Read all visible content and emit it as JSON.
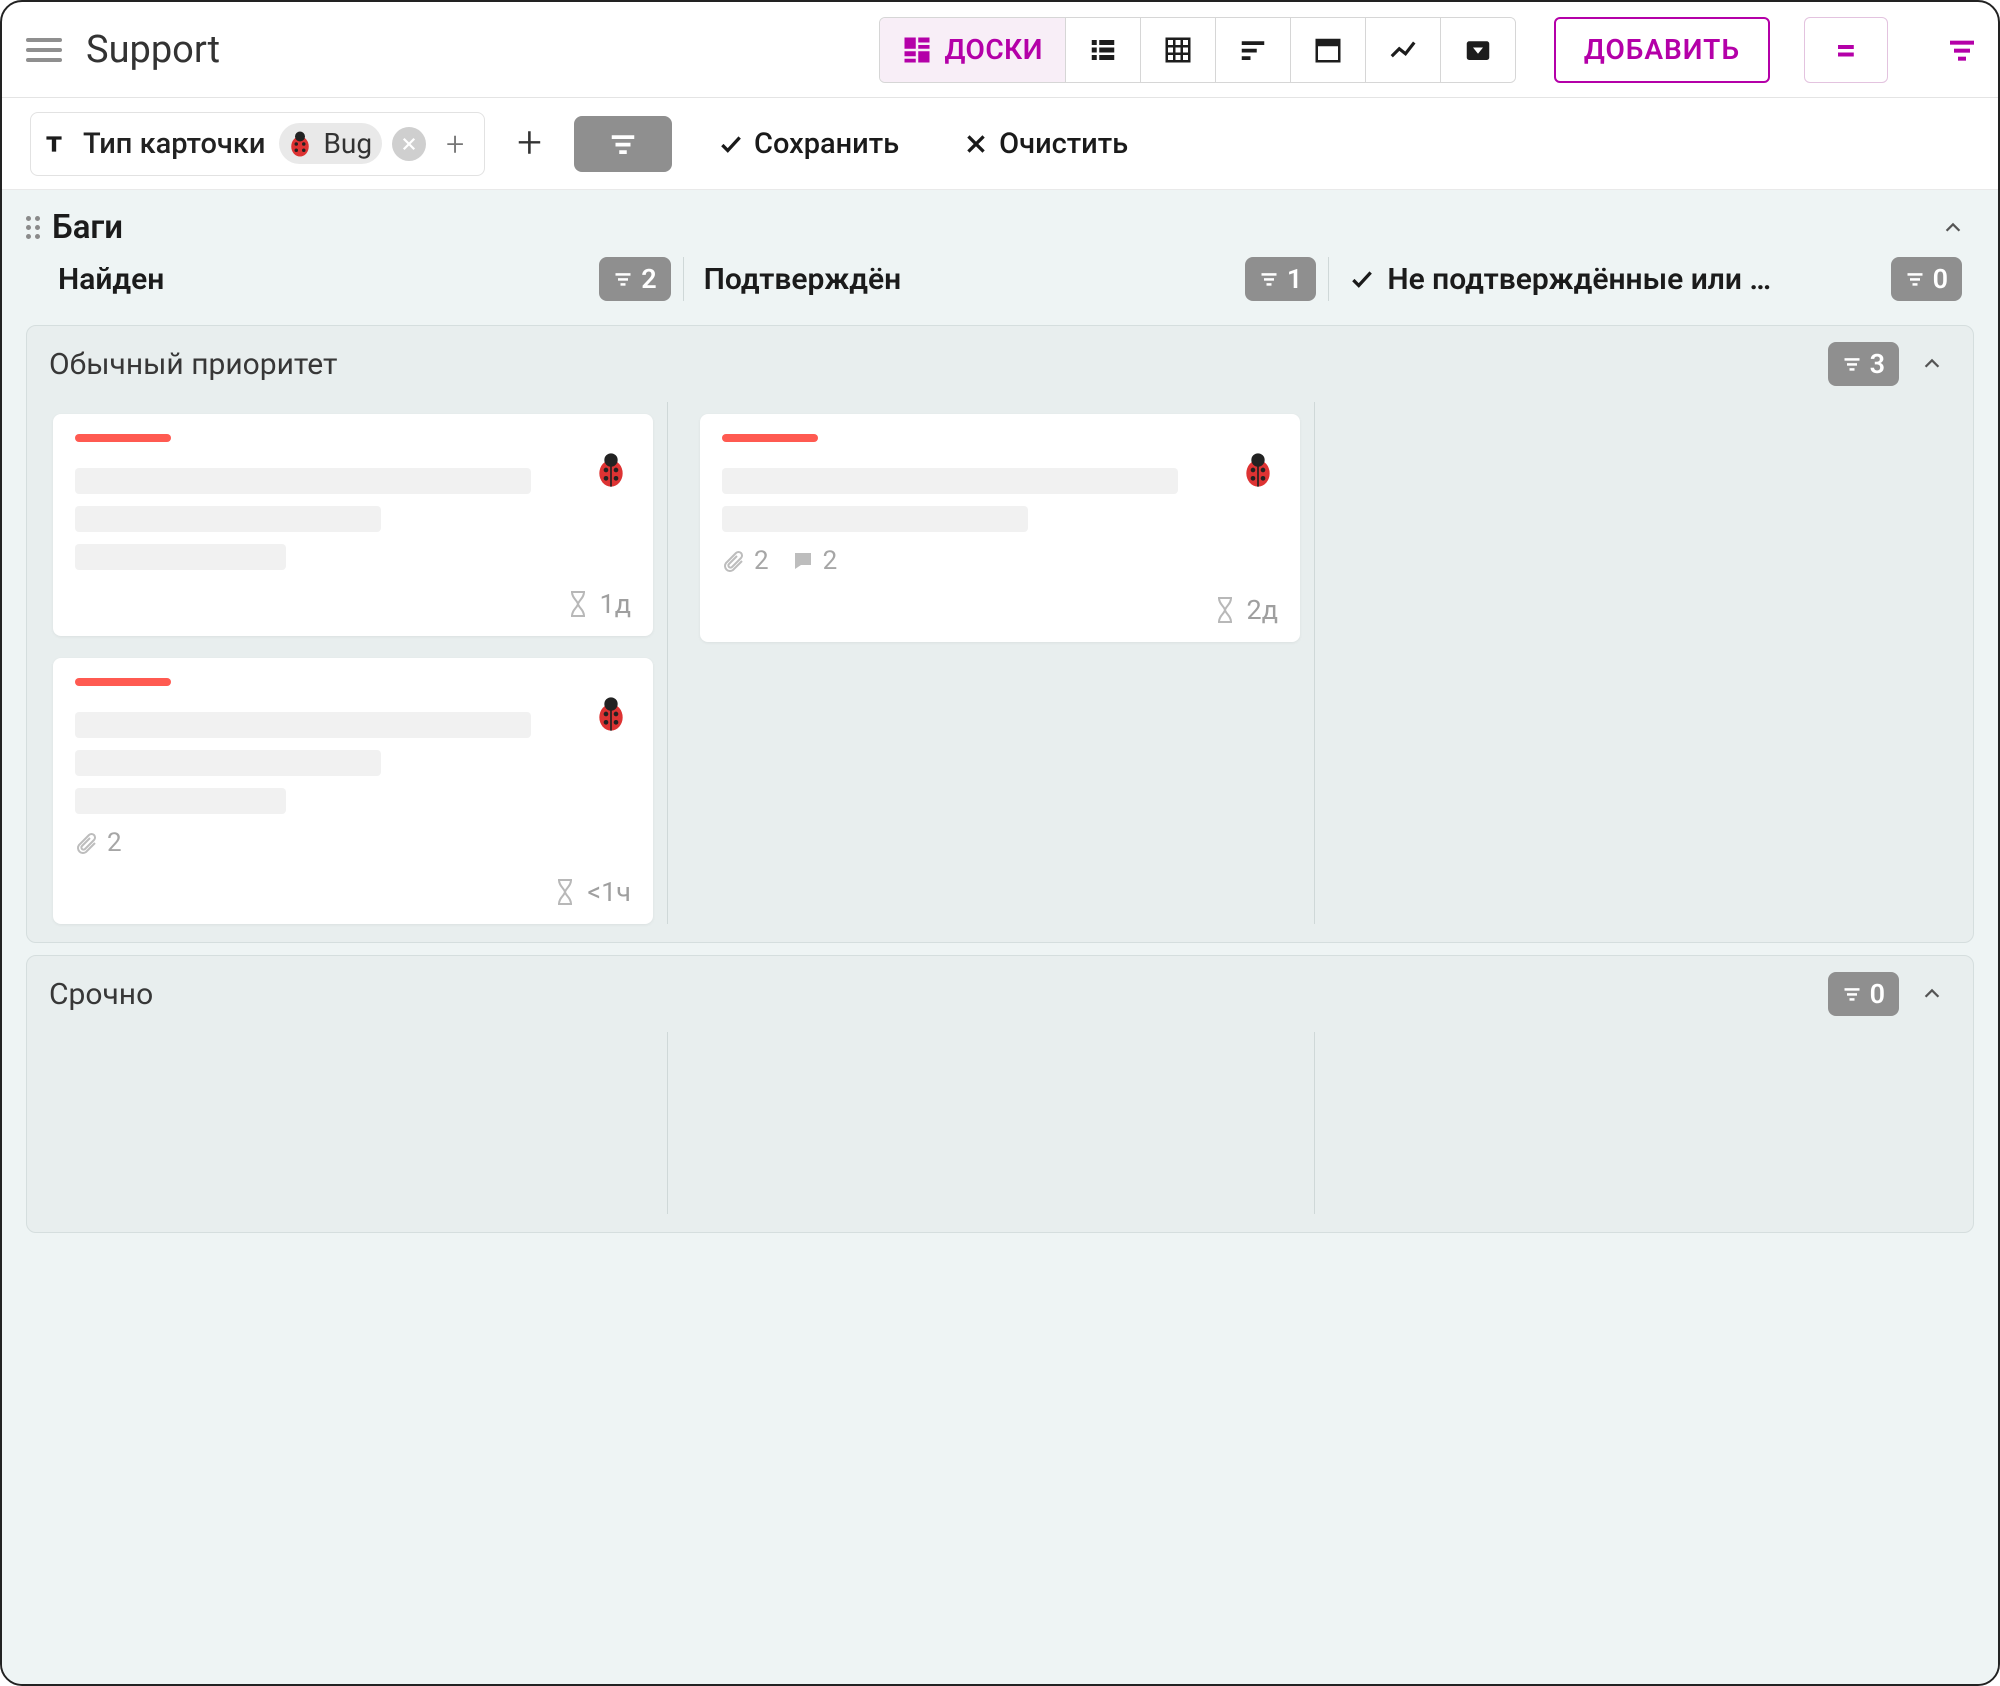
{
  "header": {
    "title": "Support",
    "views": {
      "boards_label": "ДОСКИ"
    },
    "add_label": "ДОБАВИТЬ"
  },
  "filter_bar": {
    "card_type_label": "Тип карточки",
    "card_type_value": "Bug",
    "save_label": "Сохранить",
    "clear_label": "Очистить"
  },
  "board": {
    "section_title": "Баги",
    "columns": [
      {
        "label": "Найден",
        "count": 2,
        "has_check": false
      },
      {
        "label": "Подтверждён",
        "count": 1,
        "has_check": false
      },
      {
        "label": "Не подтверждённые или …",
        "count": 0,
        "has_check": true
      }
    ],
    "swimlanes": [
      {
        "title": "Обычный приоритет",
        "total": 3,
        "columns": [
          {
            "cards": [
              {
                "time": "1д",
                "attachments": null,
                "comments": null,
                "lines": 3
              },
              {
                "time": "<1ч",
                "attachments": 2,
                "comments": null,
                "lines": 3
              }
            ]
          },
          {
            "cards": [
              {
                "time": "2д",
                "attachments": 2,
                "comments": 2,
                "lines": 2
              }
            ]
          },
          {
            "cards": []
          }
        ]
      },
      {
        "title": "Срочно",
        "total": 0,
        "columns": [
          {
            "cards": []
          },
          {
            "cards": []
          },
          {
            "cards": []
          }
        ]
      }
    ]
  }
}
